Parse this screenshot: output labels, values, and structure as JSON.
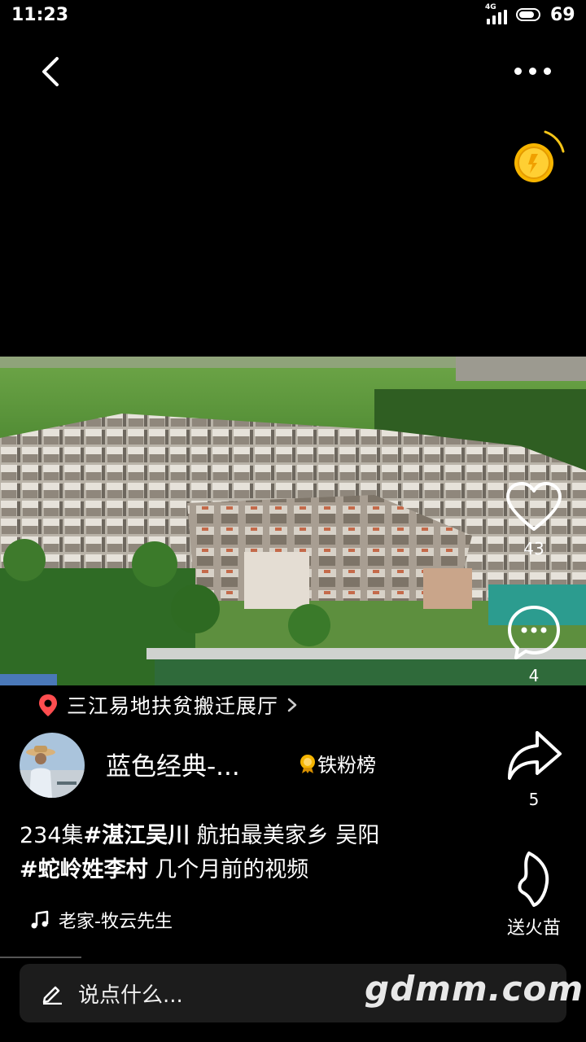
{
  "status_bar": {
    "time": "11:23",
    "network": "4G",
    "battery": "69"
  },
  "location": {
    "name": "三江易地扶贫搬迁展厅"
  },
  "author": {
    "name": "蓝色经典-...",
    "fans_badge": "铁粉榜"
  },
  "actions": {
    "likes": "43",
    "comments": "4",
    "shares": "5",
    "flame_label": "送火苗"
  },
  "description": {
    "line1": [
      {
        "text": "234集",
        "bold": false
      },
      {
        "text": "#湛江吴川",
        "bold": true
      },
      {
        "text": " 航拍最美家乡  吴阳",
        "bold": false
      }
    ],
    "line2": [
      {
        "text": "#蛇岭姓李村",
        "bold": true
      },
      {
        "text": " 几个月前的视频",
        "bold": false
      }
    ]
  },
  "music": {
    "title": "老家-牧云先生"
  },
  "comment_input": {
    "placeholder": "说点什么..."
  },
  "watermark": "gdmm.com",
  "icons": [
    "back-icon",
    "more-icon",
    "coin-icon",
    "heart-icon",
    "comment-icon",
    "share-icon",
    "flame-icon",
    "location-pin-icon",
    "chevron-right-icon",
    "medal-icon",
    "music-note-icon",
    "pencil-icon"
  ]
}
